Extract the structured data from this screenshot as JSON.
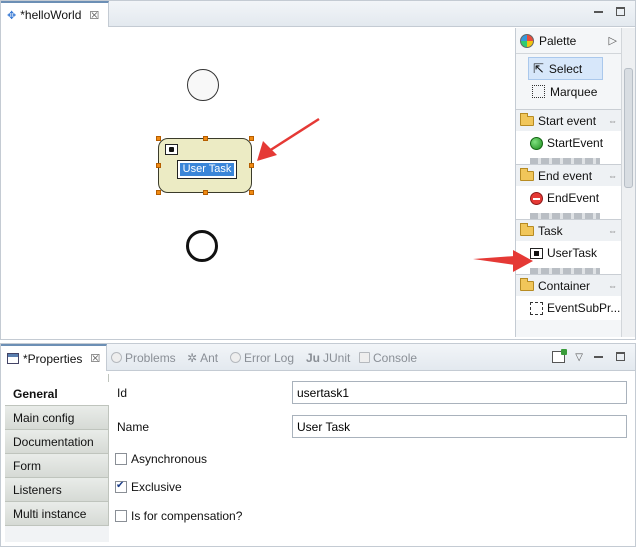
{
  "editor": {
    "tab_title": "*helloWorld",
    "task_label": "User Task"
  },
  "palette": {
    "title": "Palette",
    "tools": [
      {
        "label": "Select",
        "icon": "cursor-icon"
      },
      {
        "label": "Marquee",
        "icon": "marquee-icon"
      }
    ],
    "drawers": [
      {
        "label": "Start event",
        "item": "StartEvent",
        "icon": "start-event-icon"
      },
      {
        "label": "End event",
        "item": "EndEvent",
        "icon": "end-event-icon"
      },
      {
        "label": "Task",
        "item": "UserTask",
        "icon": "user-task-icon"
      },
      {
        "label": "Container",
        "item": "EventSubPr...",
        "icon": "event-subprocess-icon"
      }
    ]
  },
  "properties": {
    "tabs": [
      "*Properties",
      "Problems",
      "Ant",
      "Error Log",
      "JUnit",
      "Console"
    ],
    "nav": [
      "General",
      "Main config",
      "Documentation",
      "Form",
      "Listeners",
      "Multi instance"
    ],
    "fields": {
      "id_label": "Id",
      "id_value": "usertask1",
      "name_label": "Name",
      "name_value": "User Task"
    },
    "checkboxes": [
      {
        "label": "Asynchronous",
        "checked": false
      },
      {
        "label": "Exclusive",
        "checked": true
      },
      {
        "label": "Is for compensation?",
        "checked": false
      }
    ]
  },
  "colors": {
    "accent_arrow": "#e53935",
    "task_fill": "#ecebc4",
    "selection_blue": "#3a85d8",
    "handle_orange": "#f08a12"
  }
}
